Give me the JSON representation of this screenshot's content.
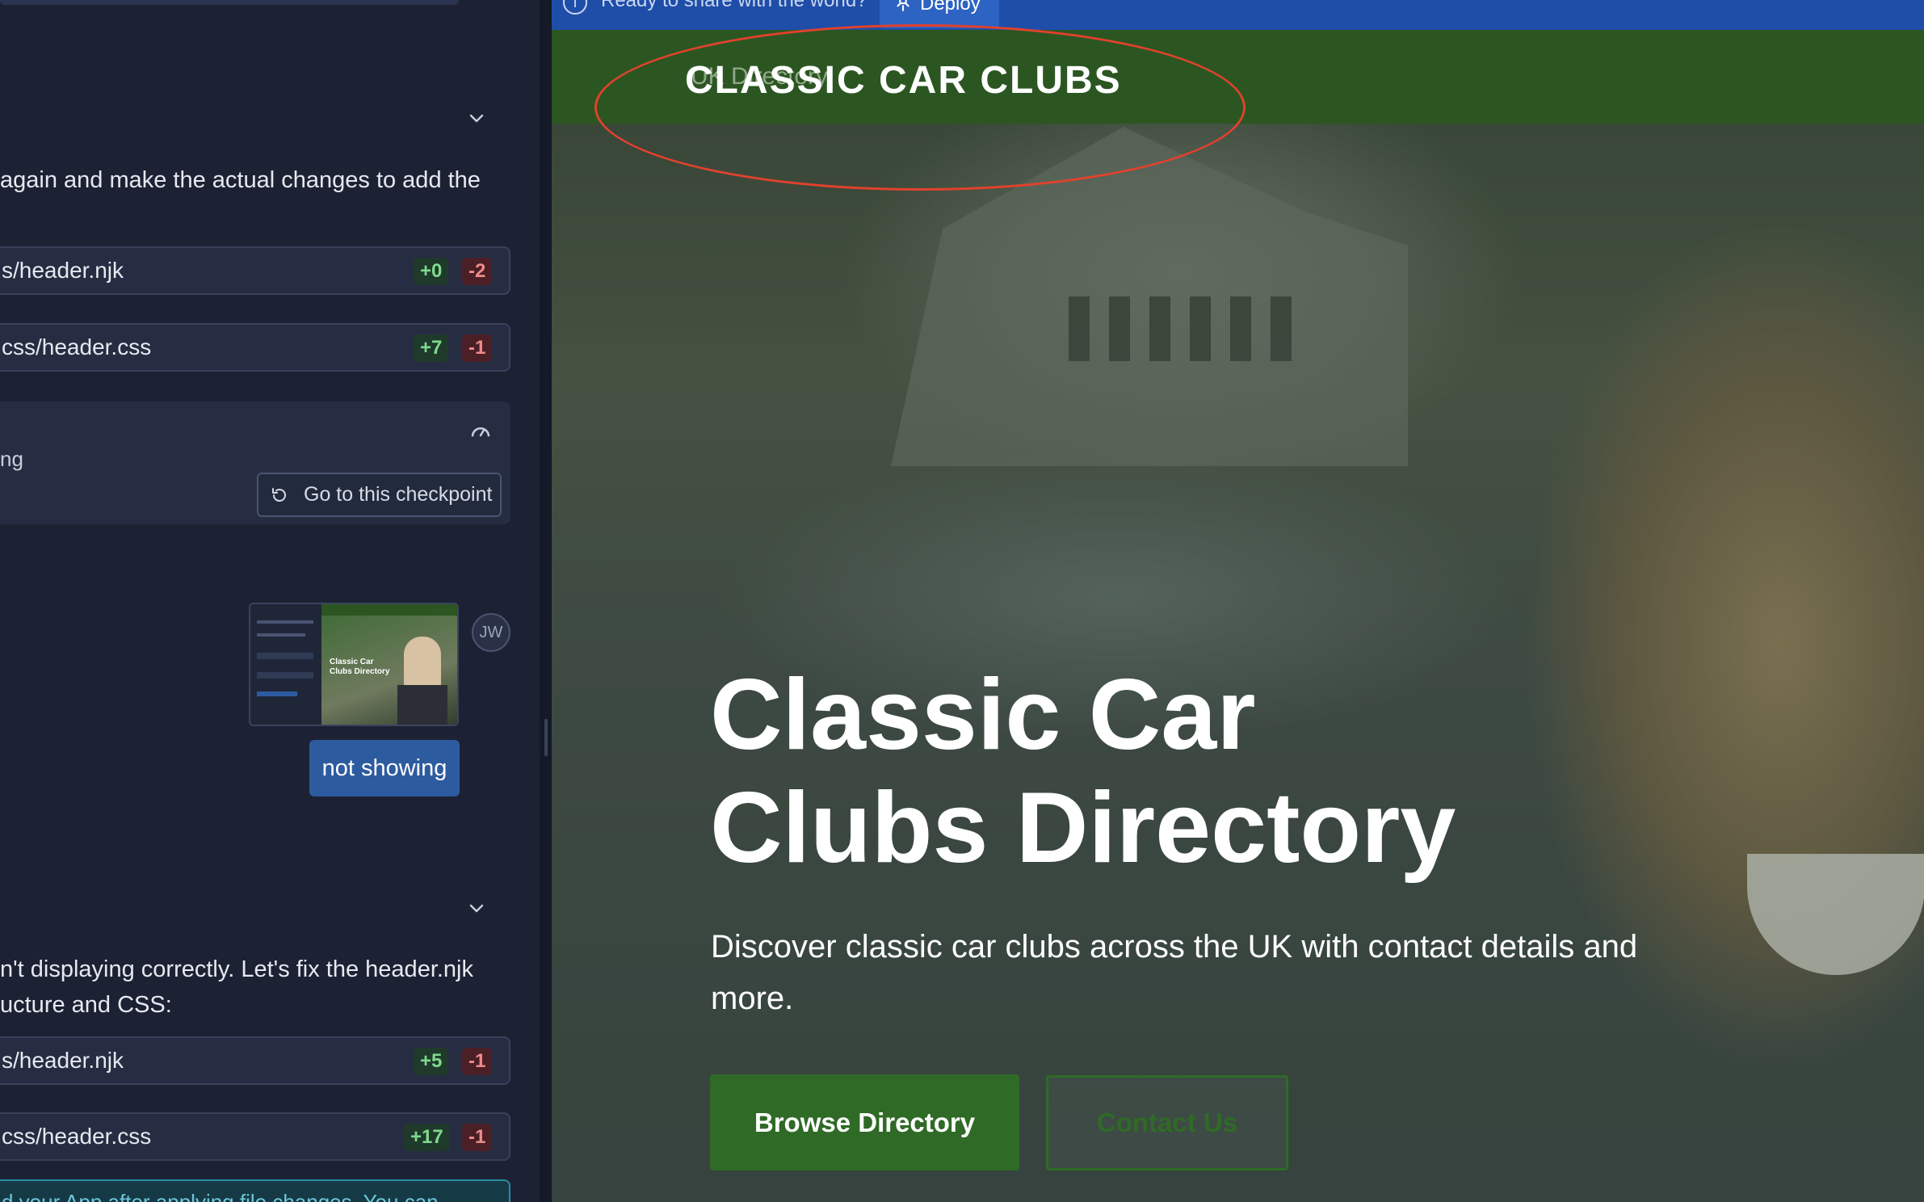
{
  "chat": {
    "msg1_text": "again and make the actual changes to add the",
    "files1": [
      {
        "name": "s/header.njk",
        "added": "+0",
        "removed": "-2"
      },
      {
        "name": "css/header.css",
        "added": "+7",
        "removed": "-1"
      }
    ],
    "checkpoint": {
      "status_fragment": "ng",
      "button_label": "Go to this checkpoint"
    },
    "user": {
      "avatar_initials": "JW",
      "message": "not showing",
      "thumbnail_title": "Classic Car Clubs Directory"
    },
    "msg2_line1": "n't displaying correctly. Let's fix the header.njk",
    "msg2_line2": "ucture and CSS:",
    "files2": [
      {
        "name": "s/header.njk",
        "added": "+5",
        "removed": "-1"
      },
      {
        "name": "css/header.css",
        "added": "+17",
        "removed": "-1"
      }
    ],
    "info_banner": "d your App after applying file changes. You can"
  },
  "preview": {
    "deploy_bar": {
      "ready_text": "Ready to share with the world?",
      "deploy_label": "Deploy"
    },
    "header": {
      "brand": "CLASSIC CAR CLUBS",
      "ghost_text": "UK Directory"
    },
    "hero": {
      "title_line1": "Classic Car",
      "title_line2": "Clubs Directory",
      "subtitle": "Discover classic car clubs across the UK with contact details and more.",
      "primary_cta": "Browse Directory",
      "secondary_cta": "Contact Us"
    }
  },
  "colors": {
    "chat_bg": "#1c2233",
    "header_green": "#2b5621",
    "cta_green": "#2f6a26",
    "deploy_blue": "#1f4ea8",
    "annotation_red": "#e2412d",
    "user_bubble": "#2d5b9f"
  }
}
